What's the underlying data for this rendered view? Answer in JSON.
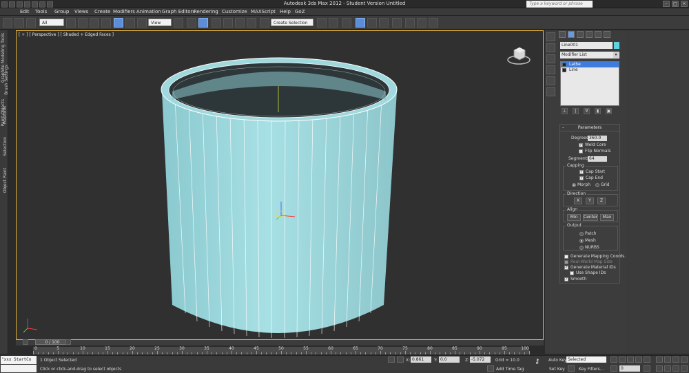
{
  "titlebar": {
    "title": "Autodesk 3ds Max  2012   -  Student Version    Untitled",
    "search_placeholder": "Type a keyword or phrase"
  },
  "menu": [
    "Edit",
    "Tools",
    "Group",
    "Views",
    "Create",
    "Modifiers",
    "Animation",
    "Graph Editors",
    "Rendering",
    "Customize",
    "MAXScript",
    "Help",
    "GoZ"
  ],
  "toolbar": {
    "filter_value": "All",
    "refcoord_value": "View",
    "selection_set_value": "Create Selection Se"
  },
  "left_ribbon": [
    "Graphite Modeling Tools",
    "Paint Objects",
    "Brush Settings",
    "Freeform",
    "Selection",
    "Object Paint"
  ],
  "viewport": {
    "label": "[ + ] [ Perspective ] [ Shaded + Edged Faces ]",
    "viewcube_face": "FRONT"
  },
  "command_panel": {
    "object_name": "Line001",
    "object_color": "#5fd4e0",
    "modifier_list": "Modifier List",
    "stack": [
      {
        "label": "Lathe",
        "selected": true
      },
      {
        "label": "Line",
        "selected": false
      }
    ],
    "parameters": {
      "title": "Parameters",
      "degrees_label": "Degrees:",
      "degrees_value": "360.0",
      "weld_core": "Weld Core",
      "flip_normals": "Flip Normals",
      "segments_label": "Segments:",
      "segments_value": "64",
      "capping_title": "Capping",
      "cap_start": "Cap Start",
      "cap_end": "Cap End",
      "morph": "Morph",
      "grid": "Grid",
      "direction_title": "Direction",
      "dir_x": "X",
      "dir_y": "Y",
      "dir_z": "Z",
      "align_title": "Align",
      "align_min": "Min",
      "align_center": "Center",
      "align_max": "Max",
      "output_title": "Output",
      "patch": "Patch",
      "mesh": "Mesh",
      "nurbs": "NURBS",
      "gen_mapping": "Generate Mapping Coords.",
      "real_world": "Real-World Map Size",
      "gen_material": "Generate Material IDs",
      "use_shape_ids": "Use Shape IDs",
      "smooth": "Smooth"
    }
  },
  "timeline": {
    "slider": "0 / 100",
    "ticks": [
      "0",
      "5",
      "10",
      "15",
      "20",
      "25",
      "30",
      "35",
      "40",
      "45",
      "50",
      "55",
      "60",
      "65",
      "70",
      "75",
      "80",
      "85",
      "90",
      "95",
      "100"
    ]
  },
  "status": {
    "maxscript": "\"xxx StartCo",
    "selected": "1 Object Selected",
    "prompt": "Click or click-and-drag to select objects",
    "x_label": "X:",
    "x_value": "0.861",
    "y_label": "Y:",
    "y_value": "0.0",
    "z_label": "Z:",
    "z_value": "-5.072",
    "grid": "Grid = 10.0",
    "add_time_tag": "Add Time Tag",
    "auto_key": "Auto Key",
    "set_key": "Set Key",
    "key_filter_select": "Selected",
    "key_filters": "Key Filters...",
    "frame_value": "0"
  }
}
